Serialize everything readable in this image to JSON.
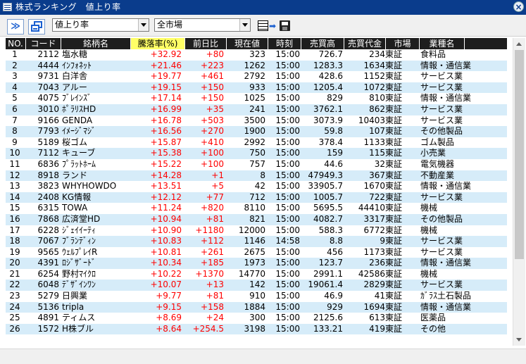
{
  "window": {
    "title": "株式ランキング　値上り率",
    "close_icon": "close-icon"
  },
  "toolbar": {
    "forward_icon": "double-chevron-right-icon",
    "forward_glyph": "≫",
    "copy_icon": "copy-window-icon",
    "ranking_type": "値上り率",
    "market": "全市場",
    "export_icon": "export-to-file-icon"
  },
  "columns": [
    "NO.",
    "コード",
    "銘柄名",
    "騰落率(%)",
    "前日比",
    "現在値",
    "時刻",
    "売買高",
    "売買代金",
    "市場",
    "業種名"
  ],
  "sorted_column": "騰落率(%)",
  "rows": [
    {
      "no": "1",
      "code": "2112",
      "name": "塩水糖",
      "pct": "+32.92",
      "chg": "+80",
      "price": "323",
      "time": "15:00",
      "volume": "726.7",
      "value": "234",
      "market": "東証",
      "industry": "食料品"
    },
    {
      "no": "2",
      "code": "4444",
      "name": "ｲﾝﾌｫﾈｯﾄ",
      "pct": "+21.46",
      "chg": "+223",
      "price": "1262",
      "time": "15:00",
      "volume": "1283.3",
      "value": "1634",
      "market": "東証",
      "industry": "情報・通信業"
    },
    {
      "no": "3",
      "code": "9731",
      "name": "白洋舎",
      "pct": "+19.77",
      "chg": "+461",
      "price": "2792",
      "time": "15:00",
      "volume": "428.6",
      "value": "1152",
      "market": "東証",
      "industry": "サービス業"
    },
    {
      "no": "4",
      "code": "7043",
      "name": "アルー",
      "pct": "+19.15",
      "chg": "+150",
      "price": "933",
      "time": "15:00",
      "volume": "1205.4",
      "value": "1072",
      "market": "東証",
      "industry": "サービス業"
    },
    {
      "no": "5",
      "code": "4075",
      "name": "ﾌﾞﾚｲﾝｽﾞ",
      "pct": "+17.14",
      "chg": "+150",
      "price": "1025",
      "time": "15:00",
      "volume": "829",
      "value": "810",
      "market": "東証",
      "industry": "情報・通信業"
    },
    {
      "no": "6",
      "code": "3010",
      "name": "ﾎﾟﾗﾘｽHD",
      "pct": "+16.99",
      "chg": "+35",
      "price": "241",
      "time": "15:00",
      "volume": "3762.1",
      "value": "862",
      "market": "東証",
      "industry": "サービス業"
    },
    {
      "no": "7",
      "code": "9166",
      "name": "GENDA",
      "pct": "+16.78",
      "chg": "+503",
      "price": "3500",
      "time": "15:00",
      "volume": "3073.9",
      "value": "10403",
      "market": "東証",
      "industry": "サービス業"
    },
    {
      "no": "8",
      "code": "7793",
      "name": "ｲﾒｰｼﾞﾏｼﾞ",
      "pct": "+16.56",
      "chg": "+270",
      "price": "1900",
      "time": "15:00",
      "volume": "59.8",
      "value": "107",
      "market": "東証",
      "industry": "その他製品"
    },
    {
      "no": "9",
      "code": "5189",
      "name": "桜ゴム",
      "pct": "+15.87",
      "chg": "+410",
      "price": "2992",
      "time": "15:00",
      "volume": "378.4",
      "value": "1133",
      "market": "東証",
      "industry": "ゴム製品"
    },
    {
      "no": "10",
      "code": "7112",
      "name": "キューブ",
      "pct": "+15.38",
      "chg": "+100",
      "price": "750",
      "time": "15:00",
      "volume": "159",
      "value": "115",
      "market": "東証",
      "industry": "小売業"
    },
    {
      "no": "11",
      "code": "6836",
      "name": "ﾌﾟﾗｯﾄﾎｰﾑ",
      "pct": "+15.22",
      "chg": "+100",
      "price": "757",
      "time": "15:00",
      "volume": "44.6",
      "value": "32",
      "market": "東証",
      "industry": "電気機器"
    },
    {
      "no": "12",
      "code": "8918",
      "name": "ランド",
      "pct": "+14.28",
      "chg": "+1",
      "price": "8",
      "time": "15:00",
      "volume": "47949.3",
      "value": "367",
      "market": "東証",
      "industry": "不動産業"
    },
    {
      "no": "13",
      "code": "3823",
      "name": "WHYHOWDO",
      "pct": "+13.51",
      "chg": "+5",
      "price": "42",
      "time": "15:00",
      "volume": "33905.7",
      "value": "1670",
      "market": "東証",
      "industry": "情報・通信業"
    },
    {
      "no": "14",
      "code": "2408",
      "name": "KG情報",
      "pct": "+12.12",
      "chg": "+77",
      "price": "712",
      "time": "15:00",
      "volume": "1005.7",
      "value": "722",
      "market": "東証",
      "industry": "サービス業"
    },
    {
      "no": "15",
      "code": "6315",
      "name": "TOWA",
      "pct": "+11.24",
      "chg": "+820",
      "price": "8110",
      "time": "15:00",
      "volume": "5695.5",
      "value": "44410",
      "market": "東証",
      "industry": "機械"
    },
    {
      "no": "16",
      "code": "7868",
      "name": "広済堂HD",
      "pct": "+10.94",
      "chg": "+81",
      "price": "821",
      "time": "15:00",
      "volume": "4082.7",
      "value": "3317",
      "market": "東証",
      "industry": "その他製品"
    },
    {
      "no": "17",
      "code": "6228",
      "name": "ｼﾞｪｲｲｰﾃｨ",
      "pct": "+10.90",
      "chg": "+1180",
      "price": "12000",
      "time": "15:00",
      "volume": "588.3",
      "value": "6772",
      "market": "東証",
      "industry": "機械"
    },
    {
      "no": "18",
      "code": "7067",
      "name": "ﾌﾞﾗﾝﾃﾞｨﾝ",
      "pct": "+10.83",
      "chg": "+112",
      "price": "1146",
      "time": "14:58",
      "volume": "8.8",
      "value": "9",
      "market": "東証",
      "industry": "サービス業"
    },
    {
      "no": "19",
      "code": "9565",
      "name": "ｳｪﾙﾌﾟﾚｲR",
      "pct": "+10.81",
      "chg": "+261",
      "price": "2675",
      "time": "15:00",
      "volume": "456",
      "value": "1173",
      "market": "東証",
      "industry": "サービス業"
    },
    {
      "no": "20",
      "code": "4391",
      "name": "ﾛｼﾞｻﾞｰﾄﾞ",
      "pct": "+10.34",
      "chg": "+185",
      "price": "1973",
      "time": "15:00",
      "volume": "123.7",
      "value": "236",
      "market": "東証",
      "industry": "情報・通信業"
    },
    {
      "no": "21",
      "code": "6254",
      "name": "野村ﾏｲｸﾛ",
      "pct": "+10.22",
      "chg": "+1370",
      "price": "14770",
      "time": "15:00",
      "volume": "2991.1",
      "value": "42586",
      "market": "東証",
      "industry": "機械"
    },
    {
      "no": "22",
      "code": "6048",
      "name": "ﾃﾞｻﾞｲﾝﾜﾝ",
      "pct": "+10.07",
      "chg": "+13",
      "price": "142",
      "time": "15:00",
      "volume": "19061.4",
      "value": "2829",
      "market": "東証",
      "industry": "サービス業"
    },
    {
      "no": "23",
      "code": "5279",
      "name": "日興業",
      "pct": "+9.77",
      "chg": "+81",
      "price": "910",
      "time": "15:00",
      "volume": "46.9",
      "value": "41",
      "market": "東証",
      "industry": "ｶﾞﾗｽ土石製品"
    },
    {
      "no": "24",
      "code": "5136",
      "name": "tripla",
      "pct": "+9.15",
      "chg": "+158",
      "price": "1884",
      "time": "15:00",
      "volume": "929",
      "value": "1694",
      "market": "東証",
      "industry": "情報・通信業"
    },
    {
      "no": "25",
      "code": "4891",
      "name": "ティムス",
      "pct": "+8.69",
      "chg": "+24",
      "price": "300",
      "time": "15:00",
      "volume": "2125.6",
      "value": "613",
      "market": "東証",
      "industry": "医薬品"
    },
    {
      "no": "26",
      "code": "1572",
      "name": "H株ブル",
      "pct": "+8.64",
      "chg": "+254.5",
      "price": "3198",
      "time": "15:00",
      "volume": "133.21",
      "value": "419",
      "market": "東証",
      "industry": "その他"
    }
  ],
  "scrollbar": {
    "up_icon": "scroll-up-arrow-icon",
    "down_icon": "scroll-down-arrow-icon"
  }
}
